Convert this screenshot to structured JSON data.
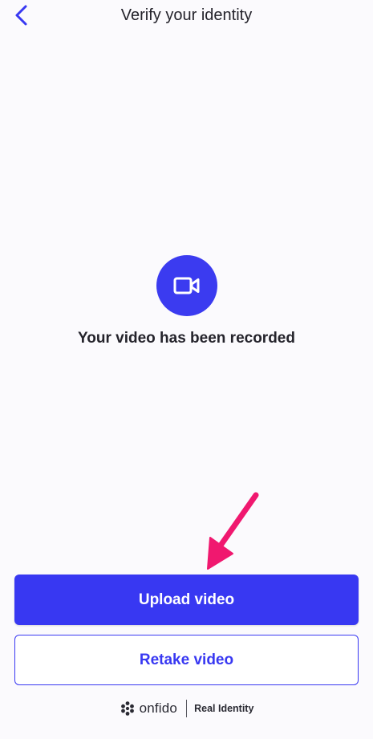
{
  "header": {
    "title": "Verify your identity",
    "back_icon": "chevron-left-icon"
  },
  "status": {
    "icon": "video-camera-icon",
    "message": "Your video has been recorded"
  },
  "actions": {
    "upload_label": "Upload video",
    "retake_label": "Retake video"
  },
  "footer": {
    "brand": "onfido",
    "tagline": "Real Identity"
  },
  "colors": {
    "accent": "#3838f2",
    "annotation_arrow": "#f0186f",
    "background": "#fbfafd"
  }
}
